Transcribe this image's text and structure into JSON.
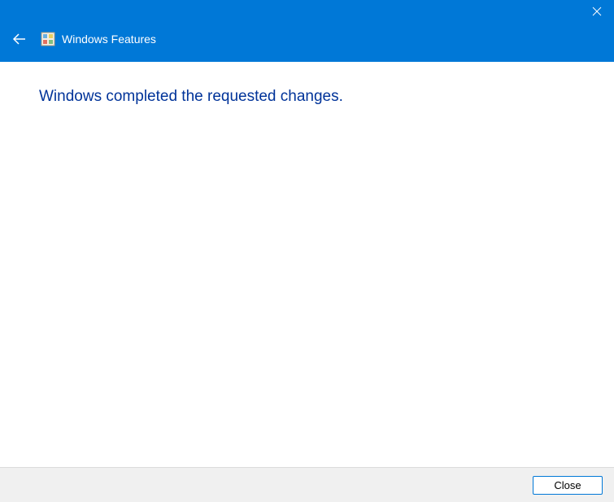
{
  "header": {
    "title": "Windows Features"
  },
  "content": {
    "message": "Windows completed the requested changes."
  },
  "footer": {
    "close_label": "Close"
  }
}
